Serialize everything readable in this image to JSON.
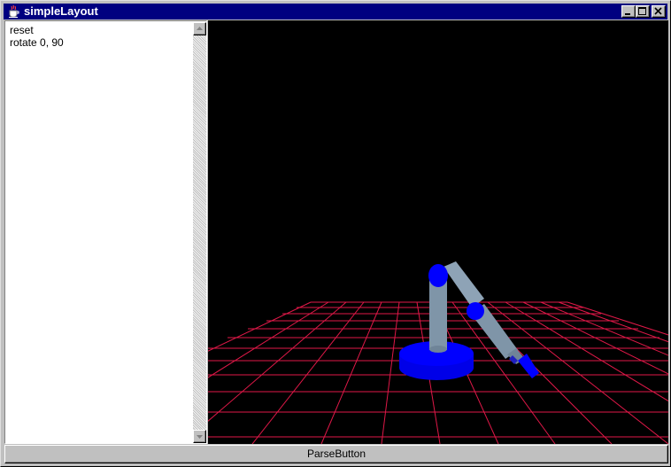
{
  "window": {
    "title": "simpleLayout"
  },
  "editor": {
    "lines": [
      "reset",
      "rotate 0, 90"
    ]
  },
  "parse_button": {
    "label": "ParseButton"
  },
  "colors": {
    "title_bar": "#000080",
    "canvas_bg": "#000000",
    "grid": "#e01848",
    "robot_blue": "#0000ff",
    "robot_arm": "#7f95a8"
  },
  "icons": [
    "java-cup-icon",
    "minimize-icon",
    "maximize-icon",
    "close-icon",
    "scroll-up-icon",
    "scroll-down-icon"
  ]
}
